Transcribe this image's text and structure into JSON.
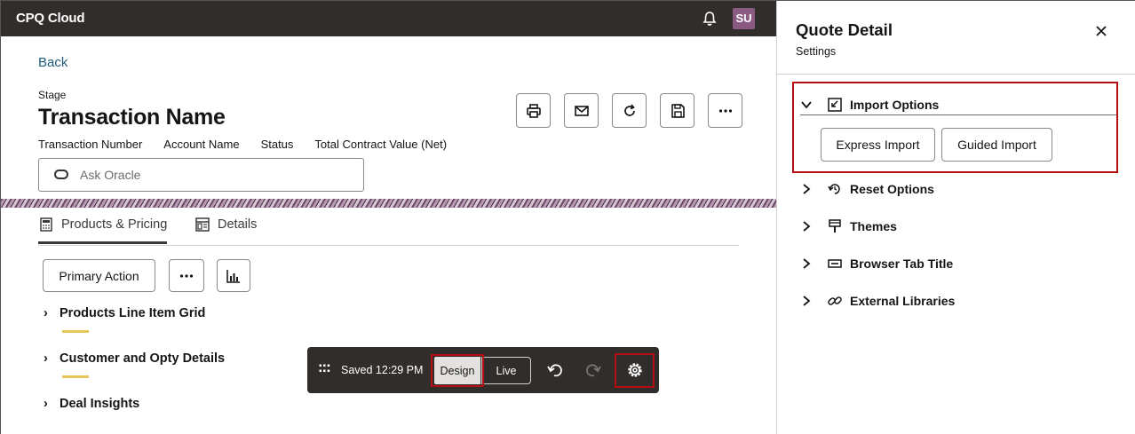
{
  "app": {
    "title": "CPQ Cloud",
    "avatar": "SU"
  },
  "main": {
    "back_label": "Back",
    "stage_label": "Stage",
    "transaction_name": "Transaction Name",
    "fields": [
      "Transaction Number",
      "Account Name",
      "Status",
      "Total Contract Value (Net)"
    ],
    "ask_placeholder": "Ask Oracle",
    "action_icons": [
      "print-icon",
      "email-icon",
      "refresh-icon",
      "save-icon",
      "more-icon"
    ],
    "tabs": [
      {
        "label": "Products & Pricing",
        "icon": "calculator-icon",
        "active": true
      },
      {
        "label": "Details",
        "icon": "details-icon",
        "active": false
      }
    ],
    "primary_action_label": "Primary Action",
    "sections": [
      "Products Line Item Grid",
      "Customer and Opty Details",
      "Deal Insights"
    ]
  },
  "toolbar": {
    "saved_text": "Saved 12:29 PM",
    "design_label": "Design",
    "live_label": "Live",
    "mode": "Design"
  },
  "panel": {
    "title": "Quote Detail",
    "subtitle": "Settings",
    "items": [
      {
        "label": "Import Options",
        "icon": "import-icon",
        "expanded": true
      },
      {
        "label": "Reset Options",
        "icon": "reset-icon",
        "expanded": false
      },
      {
        "label": "Themes",
        "icon": "themes-icon",
        "expanded": false
      },
      {
        "label": "Browser Tab Title",
        "icon": "tab-title-icon",
        "expanded": false
      },
      {
        "label": "External Libraries",
        "icon": "link-icon",
        "expanded": false
      }
    ],
    "import_buttons": [
      "Express Import",
      "Guided Import"
    ]
  },
  "colors": {
    "topbar": "#312d2a",
    "accent_highlight": "#b40d14",
    "link": "#1f5b7a",
    "section_underline": "#e6c65a"
  }
}
